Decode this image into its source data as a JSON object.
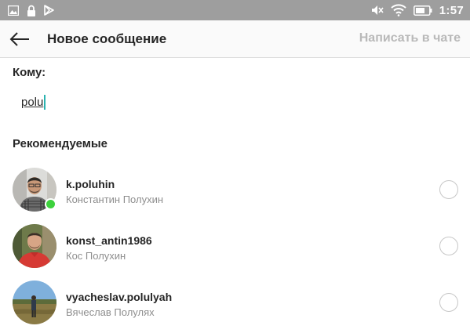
{
  "status_bar": {
    "time": "1:57",
    "left_icons": [
      "image-icon",
      "lock-icon",
      "play-store-icon"
    ],
    "right_icons": [
      "mute-icon",
      "wifi-icon",
      "battery-icon"
    ]
  },
  "header": {
    "title": "Новое сообщение",
    "chat_button": "Написать в чате",
    "back_icon": "arrow-left-icon"
  },
  "recipient": {
    "label": "Кому:",
    "value": "polu"
  },
  "suggested": {
    "title": "Рекомендуемые",
    "items": [
      {
        "username": "k.poluhin",
        "full_name": "Константин Полухин",
        "online": true,
        "selected": false
      },
      {
        "username": "konst_antin1986",
        "full_name": "Кос Полухин",
        "online": false,
        "selected": false
      },
      {
        "username": "vyacheslav.polulyah",
        "full_name": "Вячеслав Полулях",
        "online": false,
        "selected": false
      }
    ]
  },
  "colors": {
    "status_bar_bg": "#9e9e9e",
    "app_bar_bg": "#fafafa",
    "disabled_action": "#b9b9b9",
    "caret": "#2bb3b0",
    "online": "#3dd13d",
    "secondary_text": "#8e8e8e"
  }
}
